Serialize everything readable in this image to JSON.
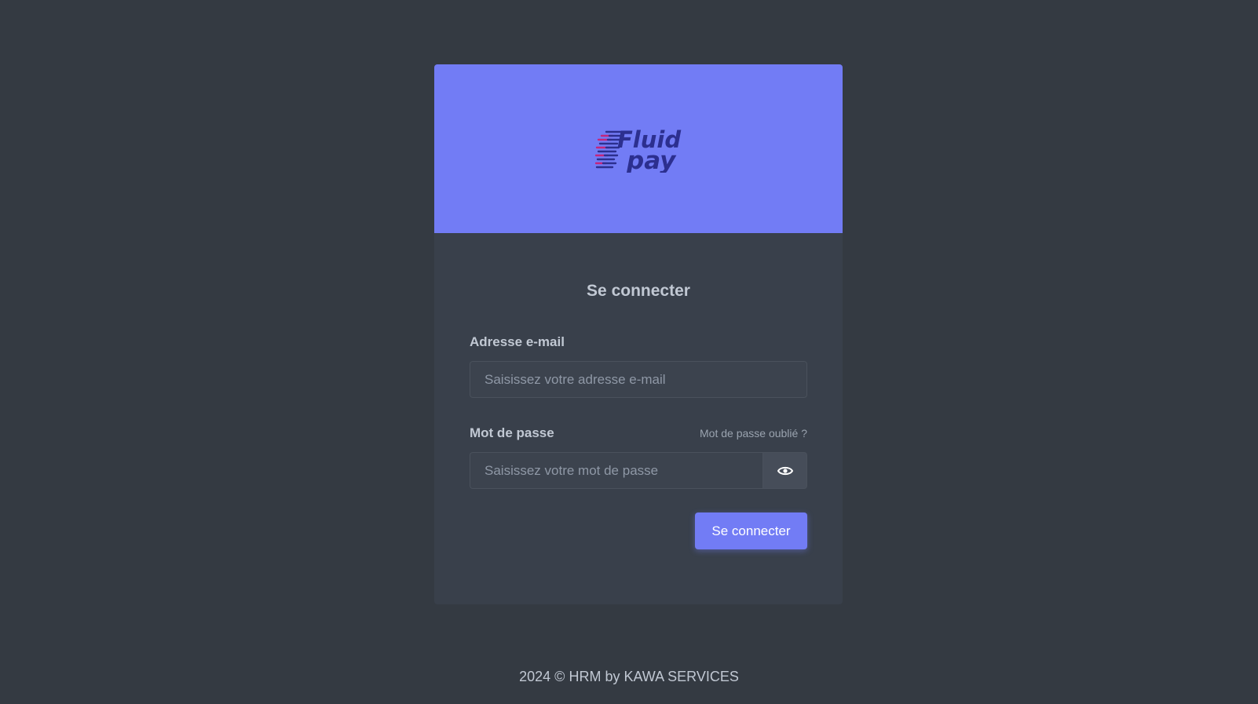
{
  "brand": {
    "logo_icon": "fluidpay-logo",
    "logo_text_top": "Fluid",
    "logo_text_bottom": "pay",
    "header_color": "#727cf5"
  },
  "login": {
    "title": "Se connecter",
    "email_label": "Adresse e-mail",
    "email_placeholder": "Saisissez votre adresse e-mail",
    "email_value": "",
    "password_label": "Mot de passe",
    "forgot_link": "Mot de passe oublié ?",
    "password_placeholder": "Saisissez votre mot de passe",
    "password_value": "",
    "toggle_icon": "eye-icon",
    "submit_label": "Se connecter"
  },
  "footer": {
    "text": "2024 © HRM by KAWA SERVICES"
  },
  "colors": {
    "background": "#343a42",
    "card": "#39404b",
    "accent": "#727cf5"
  }
}
